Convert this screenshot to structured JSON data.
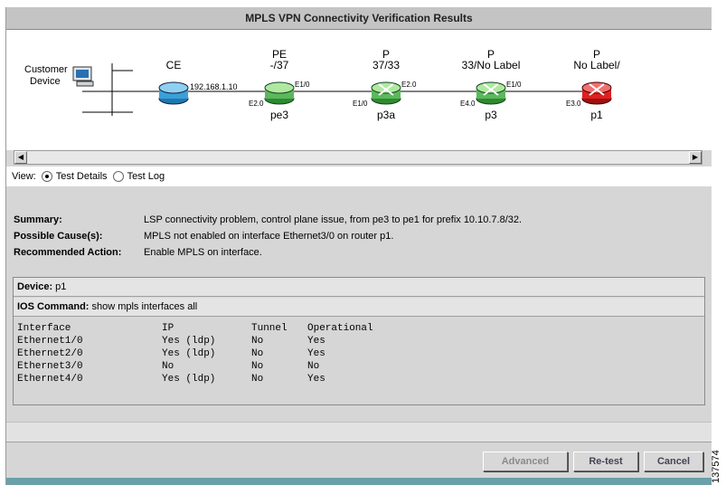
{
  "window": {
    "title": "MPLS VPN Connectivity Verification Results"
  },
  "topology": {
    "customer_label_1": "Customer",
    "customer_label_2": "Device",
    "nodes": [
      {
        "role": "CE",
        "sub": "",
        "name": "",
        "color": "#3aa0d8"
      },
      {
        "role": "PE",
        "sub": "-/37",
        "name": "pe3",
        "color": "#5cb85c"
      },
      {
        "role": "P",
        "sub": "37/33",
        "name": "p3a",
        "color": "#5cb85c"
      },
      {
        "role": "P",
        "sub": "33/No Label",
        "name": "p3",
        "color": "#5cb85c"
      },
      {
        "role": "P",
        "sub": "No Label/",
        "name": "p1",
        "color": "#e02020"
      }
    ],
    "ip": "192.168.1.10",
    "ifaces": [
      "E2.0",
      "E1/0",
      "E1/0",
      "E2.0",
      "E4.0",
      "E1/0",
      "E3.0"
    ]
  },
  "view": {
    "label": "View:",
    "option1": "Test Details",
    "option2": "Test Log"
  },
  "summary": {
    "summary_label": "Summary:",
    "summary_text": "LSP connectivity problem, control plane issue, from pe3 to pe1 for prefix 10.10.7.8/32.",
    "cause_label": "Possible Cause(s):",
    "cause_text": "MPLS not enabled on interface Ethernet3/0 on router p1.",
    "action_label": "Recommended Action:",
    "action_text": "Enable MPLS on interface."
  },
  "device": {
    "label": "Device:",
    "value": "p1"
  },
  "ios": {
    "label": "IOS Command:",
    "value": "show mpls interfaces all"
  },
  "table": {
    "headers": [
      "Interface",
      "IP",
      "Tunnel",
      "Operational"
    ],
    "rows": [
      [
        "Ethernet1/0",
        "Yes (ldp)",
        "No",
        "Yes"
      ],
      [
        "Ethernet2/0",
        "Yes (ldp)",
        "No",
        "Yes"
      ],
      [
        "Ethernet3/0",
        "No",
        "No",
        "No"
      ],
      [
        "Ethernet4/0",
        "Yes (ldp)",
        "No",
        "Yes"
      ]
    ]
  },
  "buttons": {
    "advanced": "Advanced",
    "retest": "Re-test",
    "cancel": "Cancel"
  },
  "figure_id": "137574"
}
